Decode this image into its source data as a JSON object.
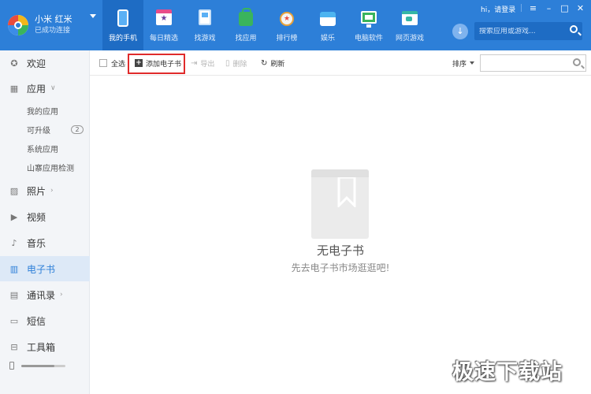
{
  "device": {
    "name": "小米 红米",
    "status": "已成功连接"
  },
  "nav": [
    {
      "label": "我的手机",
      "icon": "phone-icon",
      "active": true
    },
    {
      "label": "每日精选",
      "icon": "calendar-star-icon",
      "active": false
    },
    {
      "label": "找游戏",
      "icon": "gamepad-icon",
      "active": false
    },
    {
      "label": "找应用",
      "icon": "shopping-bag-icon",
      "active": false
    },
    {
      "label": "排行榜",
      "icon": "medal-icon",
      "active": false
    },
    {
      "label": "娱乐",
      "icon": "entertainment-icon",
      "active": false
    },
    {
      "label": "电脑软件",
      "icon": "computer-icon",
      "active": false
    },
    {
      "label": "网页游戏",
      "icon": "web-game-icon",
      "active": false
    }
  ],
  "header": {
    "greeting": "hi，请登录",
    "search_placeholder": "搜索应用或游戏..."
  },
  "sidebar": {
    "welcome": "欢迎",
    "apps": "应用",
    "apps_sub": [
      {
        "label": "我的应用"
      },
      {
        "label": "可升级",
        "badge": "2"
      },
      {
        "label": "系统应用"
      },
      {
        "label": "山寨应用检测"
      }
    ],
    "photos": "照片",
    "videos": "视频",
    "music": "音乐",
    "ebooks": "电子书",
    "contacts": "通讯录",
    "sms": "短信",
    "toolbox": "工具箱",
    "storage_used_fraction": 0.75
  },
  "toolbar": {
    "select_all": "全选",
    "add_ebook": "添加电子书",
    "export": "导出",
    "delete": "删除",
    "refresh": "刷新",
    "sort": "排序"
  },
  "empty": {
    "title": "无电子书",
    "subtitle": "先去电子书市场逛逛吧!"
  },
  "watermark": "极速下载站",
  "colors": {
    "primary": "#2d7fd8",
    "primary_dark": "#1e6cc4",
    "highlight_border": "#e02b2b"
  }
}
